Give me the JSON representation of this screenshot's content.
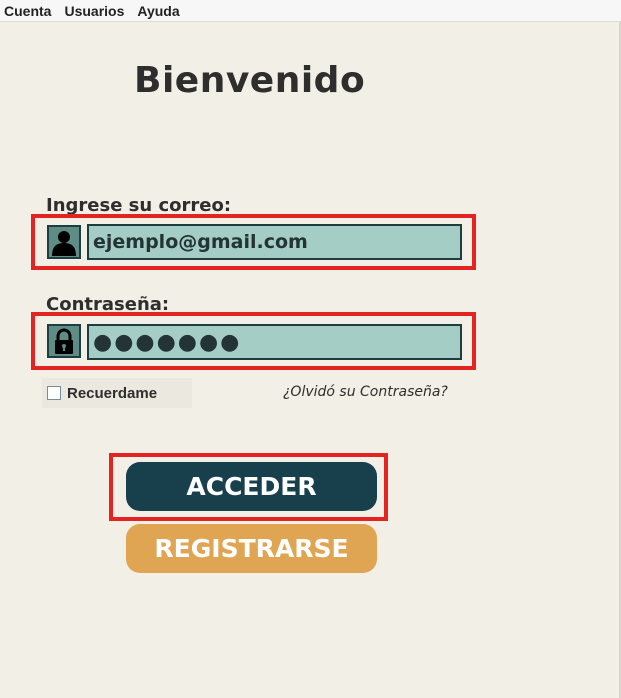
{
  "menubar": {
    "items": [
      "Cuenta",
      "Usuarios",
      "Ayuda"
    ]
  },
  "login": {
    "title": "Bienvenido",
    "email_label": "Ingrese su correo:",
    "email_value": "ejemplo@gmail.com",
    "password_label": "Contraseña:",
    "password_value": "●●●●●●●",
    "remember_label": "Recuerdame",
    "forgot_link": "¿Olvidó su Contraseña?",
    "login_button": "ACCEDER",
    "register_button": "REGISTRARSE"
  },
  "colors": {
    "background": "#f2efe6",
    "field_bg": "#a3cdc5",
    "login_button": "#173f4c",
    "register_button": "#dfa553",
    "highlight": "#e32420"
  },
  "icons": {
    "email": "user-icon",
    "password": "lock-icon"
  }
}
